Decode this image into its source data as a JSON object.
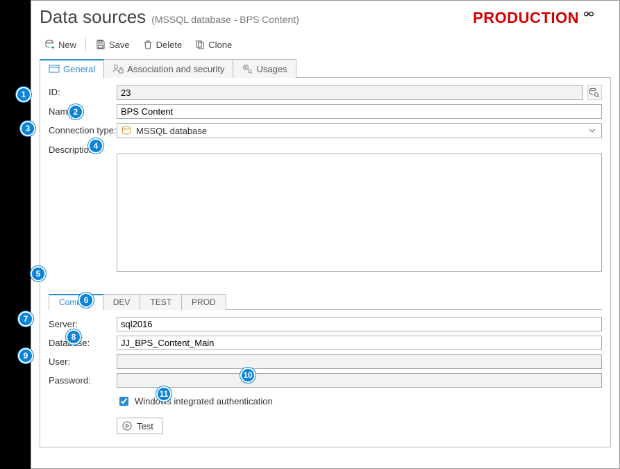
{
  "header": {
    "title": "Data sources",
    "subtitle": "(MSSQL database - BPS Content)",
    "environment": "PRODUCTION"
  },
  "toolbar": {
    "new_label": "New",
    "save_label": "Save",
    "delete_label": "Delete",
    "clone_label": "Clone"
  },
  "mainTabs": {
    "general": "General",
    "assoc": "Association and security",
    "usages": "Usages"
  },
  "general": {
    "id_label": "ID:",
    "id_value": "23",
    "name_label": "Name:",
    "name_value": "BPS Content",
    "conn_label": "Connection type:",
    "conn_value": "MSSQL database",
    "desc_label": "Description:",
    "desc_value": ""
  },
  "envTabs": {
    "common": "Common",
    "dev": "DEV",
    "test": "TEST",
    "prod": "PROD"
  },
  "conn": {
    "server_label": "Server:",
    "server_value": "sql2016",
    "db_label": "Database:",
    "db_value": "JJ_BPS_Content_Main",
    "user_label": "User:",
    "user_value": "",
    "pw_label": "Password:",
    "pw_value": "",
    "winauth_label": "Windows integrated authentication",
    "winauth_checked": true,
    "test_label": "Test"
  },
  "callouts": {
    "1": "1",
    "2": "2",
    "3": "3",
    "4": "4",
    "5": "5",
    "6": "6",
    "7": "7",
    "8": "8",
    "9": "9",
    "10": "10",
    "11": "11"
  },
  "colors": {
    "accent": "#2d89cf",
    "production": "#d40000",
    "callout": "#0a84d8"
  }
}
